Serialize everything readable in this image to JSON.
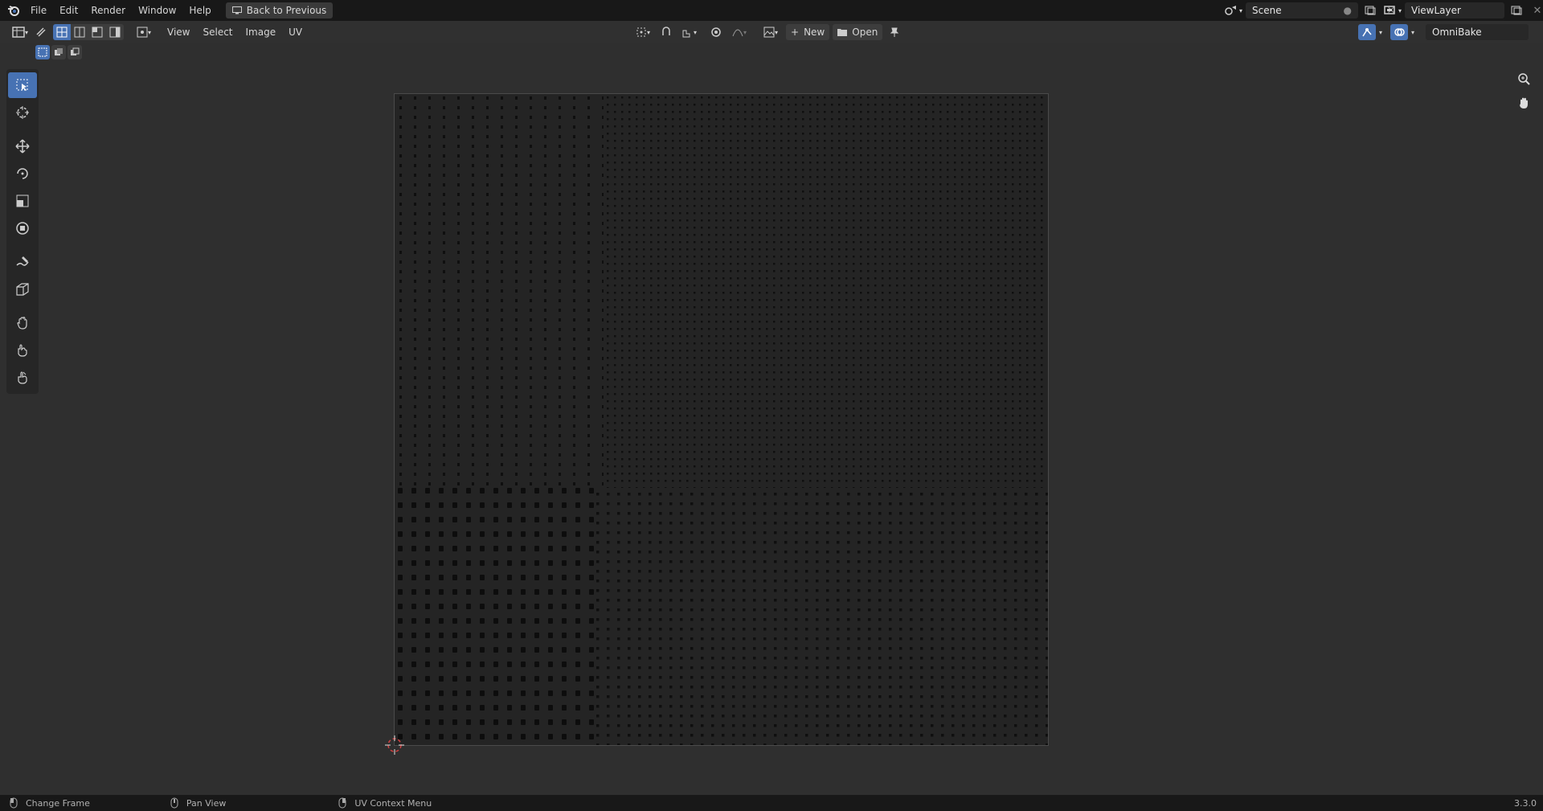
{
  "topbar": {
    "menus": [
      "File",
      "Edit",
      "Render",
      "Window",
      "Help"
    ],
    "back_button": "Back to Previous",
    "scene_name": "Scene",
    "view_layer": "ViewLayer"
  },
  "header": {
    "menus": [
      "View",
      "Select",
      "Image",
      "UV"
    ],
    "new_label": "New",
    "open_label": "Open",
    "uv_map": "OmniBake"
  },
  "toolbar": {
    "tools": [
      "select-box",
      "cursor",
      "move",
      "rotate",
      "scale",
      "transform",
      "annotate",
      "rip",
      "grab",
      "relax",
      "pinch"
    ]
  },
  "status": {
    "items": [
      "Change Frame",
      "Pan View",
      "UV Context Menu"
    ],
    "version": "3.3.0"
  },
  "colors": {
    "accent": "#4772b3",
    "background": "#2f2f2f"
  }
}
